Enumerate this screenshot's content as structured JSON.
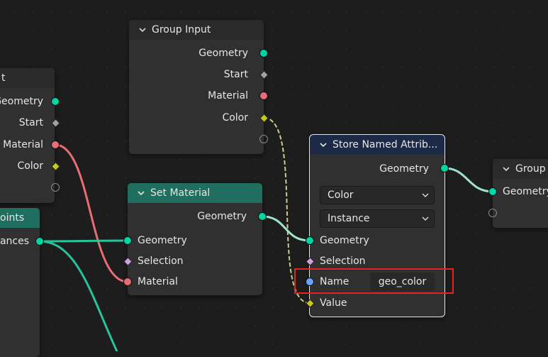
{
  "nodes": {
    "group_input_partial": {
      "title": "t",
      "outputs": [
        "Geometry",
        "Start",
        "Material",
        "Color"
      ]
    },
    "group_input": {
      "title": "Group Input",
      "outputs": [
        "Geometry",
        "Start",
        "Material",
        "Color"
      ]
    },
    "points_partial": {
      "title": "oints",
      "outputs": [
        "ances"
      ]
    },
    "set_material": {
      "title": "Set Material",
      "output": "Geometry",
      "inputs": [
        "Geometry",
        "Selection",
        "Material"
      ]
    },
    "store_named_attribute": {
      "title": "Store Named Attrib...",
      "output": "Geometry",
      "data_type": "Color",
      "domain": "Instance",
      "inputs": [
        "Geometry",
        "Selection",
        "Name",
        "Value"
      ],
      "name_value": "geo_color"
    },
    "group_output_partial": {
      "title": "Group",
      "inputs": [
        "Geometry"
      ]
    }
  },
  "colors": {
    "geometry_socket": "#00d6a3",
    "float_socket": "#a1a1a1",
    "material_socket": "#e86d74",
    "color_socket": "#c7c729",
    "boolean_socket": "#cca5e0",
    "string_socket": "#6ba2ff",
    "highlight": "#e8231f"
  },
  "icons": {
    "collapse": "chevron-down-icon",
    "dropdown": "chevron-down-icon"
  }
}
